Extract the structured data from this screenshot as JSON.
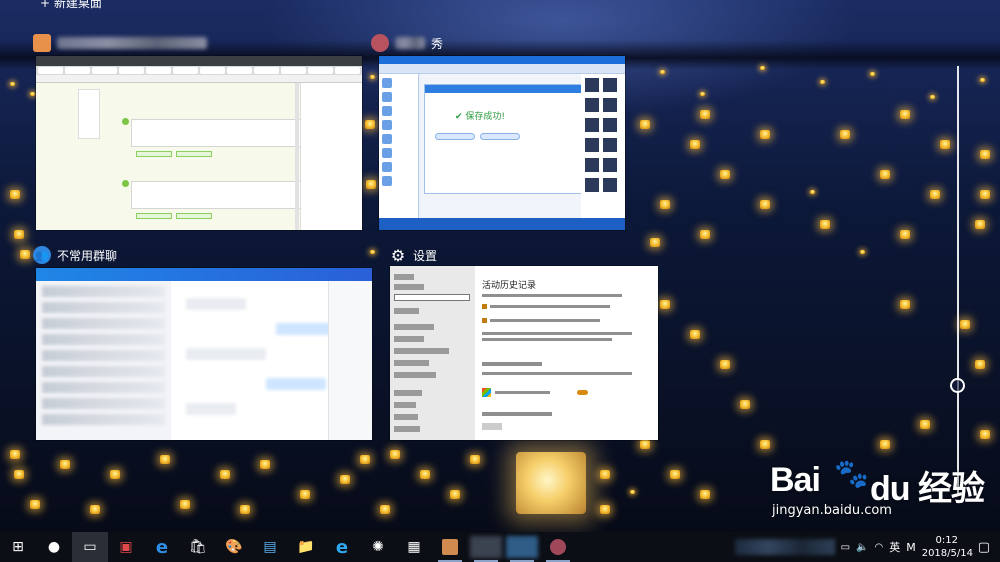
{
  "desktop": {
    "new_desktop_label": "+ 新建桌面"
  },
  "windows": [
    {
      "title": "",
      "app_icon": "browser-icon",
      "icon_color": "#e8914a"
    },
    {
      "title": "秀",
      "app_icon": "photo-editor-icon",
      "icon_color": "#b8525f"
    },
    {
      "title": "不常用群聊",
      "app_icon": "chat-icon",
      "icon_color": "#2e86de"
    },
    {
      "title": "设置",
      "app_icon": "gear-icon",
      "icon_color": "#ffffff"
    }
  ],
  "editor_dialog": {
    "success_text": "保存成功!"
  },
  "settings_window": {
    "back_label": "设置",
    "home_label": "主页",
    "page_title": "活动历史记录",
    "section_accounts": "显示账户的活动",
    "section_clear": "清除活动历史记录",
    "clear_button": "清除"
  },
  "timeline": {
    "position": 0.74
  },
  "watermark": {
    "brand": "Bai",
    "brand_suffix": "du 经验",
    "url": "jingyan.baidu.com"
  },
  "taskbar": {
    "pinned": [
      {
        "name": "start-icon",
        "glyph": "⊞"
      },
      {
        "name": "cortana-icon",
        "glyph": "●"
      },
      {
        "name": "task-view-icon",
        "glyph": "▭"
      },
      {
        "name": "media-player-icon",
        "glyph": "▣"
      },
      {
        "name": "edge-icon",
        "glyph": "e"
      },
      {
        "name": "store-icon",
        "glyph": "🛍"
      },
      {
        "name": "paint-icon",
        "glyph": "🎨"
      },
      {
        "name": "app-card-icon",
        "glyph": "▤"
      },
      {
        "name": "file-explorer-icon",
        "glyph": "📁"
      },
      {
        "name": "ie-icon",
        "glyph": "e"
      },
      {
        "name": "sun-app-icon",
        "glyph": "✺"
      },
      {
        "name": "calculator-icon",
        "glyph": "▦"
      }
    ],
    "ime": "英",
    "ime_mode": "M",
    "time": "0:12",
    "date": "2018/5/14"
  },
  "colors": {
    "taskbar_bg": "#0b0e14",
    "accent": "#2e86de",
    "lantern_glow": "#f7c233"
  }
}
